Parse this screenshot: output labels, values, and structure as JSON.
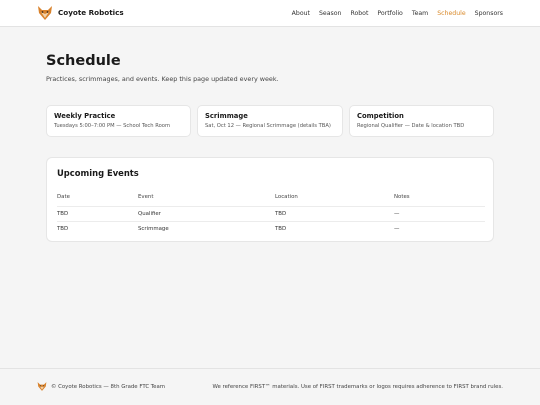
{
  "header": {
    "brand_name": "Coyote Robotics",
    "logo_icon": "coyote-logo-icon",
    "nav": [
      {
        "label": "About"
      },
      {
        "label": "Season"
      },
      {
        "label": "Robot"
      },
      {
        "label": "Portfolio"
      },
      {
        "label": "Team"
      },
      {
        "label": "Schedule",
        "active": true
      },
      {
        "label": "Sponsors"
      }
    ]
  },
  "hero": {
    "title": "Schedule",
    "subtitle": "Practices, scrimmages, and events. Keep this page updated every week."
  },
  "cards": [
    {
      "title": "Weekly Practice",
      "text": "Tuesdays 5:00–7:00 PM — School Tech Room"
    },
    {
      "title": "Scrimmage",
      "text": "Sat, Oct 12 — Regional Scrimmage (details TBA)"
    },
    {
      "title": "Competition",
      "text": "Regional Qualifier — Date & location TBD"
    }
  ],
  "events": {
    "title": "Upcoming Events",
    "headers": [
      "Date",
      "Event",
      "Location",
      "Notes"
    ],
    "rows": [
      [
        "TBD",
        "Qualifier",
        "TBD",
        "—"
      ],
      [
        "TBD",
        "Scrimmage",
        "TBD",
        "—"
      ]
    ]
  },
  "footer": {
    "left": "© Coyote Robotics — 8th Grade FTC Team",
    "right": "We reference FIRST™ materials. Use of FIRST trademarks or logos requires adherence to FIRST brand rules."
  },
  "colors": {
    "accent": "#d98a2b",
    "background": "#f5f5f5",
    "card": "#ffffff"
  }
}
